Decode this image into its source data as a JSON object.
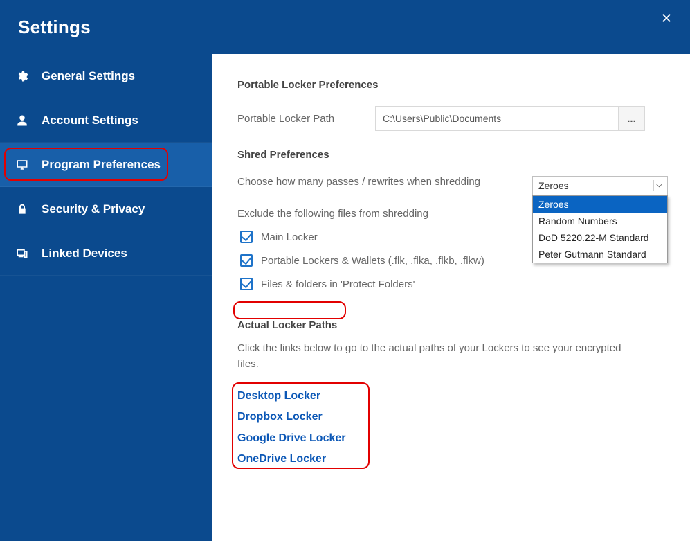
{
  "titlebar": {
    "title": "Settings"
  },
  "sidebar": {
    "items": [
      {
        "label": "General Settings"
      },
      {
        "label": "Account Settings"
      },
      {
        "label": "Program Preferences"
      },
      {
        "label": "Security & Privacy"
      },
      {
        "label": "Linked Devices"
      }
    ]
  },
  "portable": {
    "section_title": "Portable Locker Preferences",
    "path_label": "Portable Locker Path",
    "path_value": "C:\\Users\\Public\\Documents",
    "browse_label": "..."
  },
  "shred": {
    "section_title": "Shred Preferences",
    "passes_label": "Choose how many passes / rewrites when shredding",
    "selected": "Zeroes",
    "options": [
      "Zeroes",
      "Random Numbers",
      "DoD 5220.22-M Standard",
      "Peter Gutmann Standard"
    ],
    "exclude_label": "Exclude the following files from shredding",
    "checks": [
      "Main Locker",
      "Portable Lockers & Wallets (.flk, .flka, .flkb, .flkw)",
      "Files & folders in 'Protect Folders'"
    ]
  },
  "actual": {
    "section_title": "Actual Locker Paths",
    "desc": "Click the links below to go to the actual paths of your Lockers to see your encrypted files.",
    "links": [
      "Desktop Locker",
      "Dropbox Locker",
      "Google Drive Locker",
      "OneDrive Locker"
    ]
  }
}
